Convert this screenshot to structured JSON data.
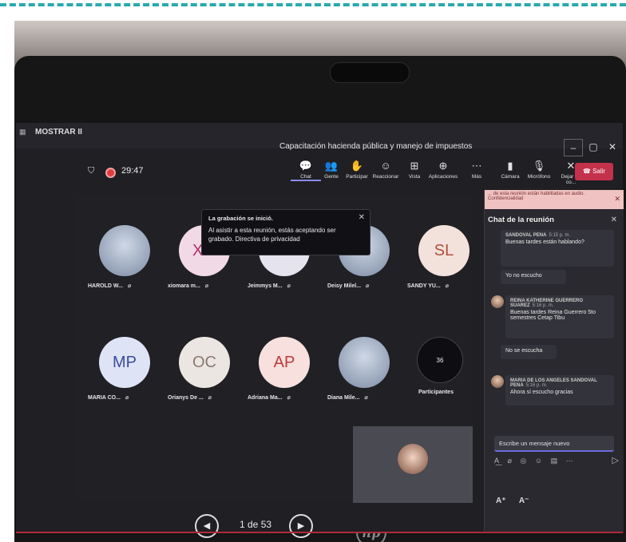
{
  "titlebar": {
    "app_label": "MOSTRAR II",
    "title": "Capacitación hacienda pública y manejo de impuestos"
  },
  "header": {
    "timer": "29:47",
    "tools": [
      {
        "label": "Chat",
        "icon": "chat-icon",
        "glyph": "💬",
        "active": true
      },
      {
        "label": "Gente",
        "icon": "people-icon",
        "glyph": "👥"
      },
      {
        "label": "Participar",
        "icon": "raise-hand-icon",
        "glyph": "✋"
      },
      {
        "label": "Reaccionar",
        "icon": "react-icon",
        "glyph": "☺"
      },
      {
        "label": "Vista",
        "icon": "view-icon",
        "glyph": "⊞"
      },
      {
        "label": "Aplicaciones",
        "icon": "apps-icon",
        "glyph": "⊕"
      },
      {
        "label": "Más",
        "icon": "more-icon",
        "glyph": "⋯"
      },
      {
        "label": "Cámara",
        "icon": "camera-off-icon",
        "glyph": "▮"
      },
      {
        "label": "Micrófono",
        "icon": "mic-off-icon",
        "glyph": "🎙"
      },
      {
        "label": "Dejar de co...",
        "icon": "stop-share-icon",
        "glyph": "✕"
      }
    ],
    "leave_label": "Salir"
  },
  "toast": {
    "title": "La grabación se inició.",
    "body": "Al asistir a esta reunión, estás aceptando ser grabado. Directiva de privacidad"
  },
  "tiles": [
    {
      "name": "HAROLD W...",
      "initials": "",
      "photo": true
    },
    {
      "name": "xiomara m...",
      "initials": "XM",
      "bg": "#f2d9e6",
      "fg": "#b0306a"
    },
    {
      "name": "Jeimmys M...",
      "initials": "JL",
      "bg": "#e5e3ee",
      "fg": "#6a6482"
    },
    {
      "name": "Deisy Milel...",
      "initials": "",
      "photo": true
    },
    {
      "name": "SANDY YU...",
      "initials": "SL",
      "bg": "#f3e1dc",
      "fg": "#b0503a"
    },
    {
      "name": "MARIA CO...",
      "initials": "MP",
      "bg": "#dfe3f6",
      "fg": "#3a4a9a"
    },
    {
      "name": "Orianys De ...",
      "initials": "OC",
      "bg": "#ece6e2",
      "fg": "#8a7a70"
    },
    {
      "name": "Adriana Ma...",
      "initials": "AP",
      "bg": "#f7e0de",
      "fg": "#c0393a"
    },
    {
      "name": "Diana Mile...",
      "initials": "",
      "photo": true
    }
  ],
  "participants": {
    "count": "36",
    "label": "Participantes"
  },
  "pager": {
    "label": "1 de 53"
  },
  "chat": {
    "banner": "... de esta reunión están habilitadas en audio. Confidencialidad",
    "title": "Chat de la reunión",
    "messages": [
      {
        "sender": "SANDOVAL PENA",
        "time": "5:15 p. m.",
        "text": "Buenas tardes están hablando?"
      },
      {
        "sender": "",
        "time": "",
        "text": "Yo no escucho"
      },
      {
        "sender": "REINA KATHERINE GUERRERO SUAREZ",
        "time": "5:16 p. m.",
        "text": "Buenas tardes Reina Guerrero 5to semestres Cetap Tibu"
      },
      {
        "sender": "",
        "time": "",
        "text": "No se escucha"
      },
      {
        "sender": "MARIA DE LOS ANGELES SANDOVAL PENA",
        "time": "5:16 p. m.",
        "text": "Ahora sí escucho gracias"
      }
    ],
    "compose_placeholder": "Escribe un mensaje nuevo"
  }
}
